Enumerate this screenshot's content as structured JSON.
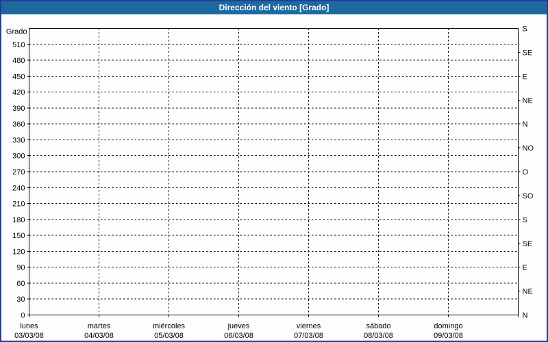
{
  "window": {
    "title": "Dirección del viento [Grado]"
  },
  "colors": {
    "title_bar_bg": "#1d6aa1",
    "title_text": "#ffffff",
    "outer_border": "#233d99",
    "background": "#fdfdfd",
    "axis_line": "#000000",
    "grid_line": "#000000",
    "tick_text": "#000000"
  },
  "chart_data": {
    "type": "line",
    "title": "Dirección del viento [Grado]",
    "ylabel": "Grado",
    "ylim": [
      0,
      540
    ],
    "y_tick_step": 30,
    "y_ticks": [
      0,
      30,
      60,
      90,
      120,
      150,
      180,
      210,
      240,
      270,
      300,
      330,
      360,
      390,
      420,
      450,
      480,
      510
    ],
    "right_axis": {
      "tick_step": 45,
      "ticks": [
        {
          "value": 0,
          "label": "N"
        },
        {
          "value": 45,
          "label": "NE"
        },
        {
          "value": 90,
          "label": "E"
        },
        {
          "value": 135,
          "label": "SE"
        },
        {
          "value": 180,
          "label": "S"
        },
        {
          "value": 225,
          "label": "SO"
        },
        {
          "value": 270,
          "label": "O"
        },
        {
          "value": 315,
          "label": "NO"
        },
        {
          "value": 360,
          "label": "N"
        },
        {
          "value": 405,
          "label": "NE"
        },
        {
          "value": 450,
          "label": "E"
        },
        {
          "value": 495,
          "label": "SE"
        },
        {
          "value": 540,
          "label": "S"
        }
      ]
    },
    "x_axis": {
      "days": [
        {
          "weekday": "lunes",
          "date": "03/03/08"
        },
        {
          "weekday": "martes",
          "date": "04/03/08"
        },
        {
          "weekday": "miércoles",
          "date": "05/03/08"
        },
        {
          "weekday": "jueves",
          "date": "06/03/08"
        },
        {
          "weekday": "viernes",
          "date": "07/03/08"
        },
        {
          "weekday": "sábado",
          "date": "08/03/08"
        },
        {
          "weekday": "domingo",
          "date": "09/03/08"
        }
      ]
    },
    "grid": "dashed",
    "legend": "none",
    "series": []
  }
}
